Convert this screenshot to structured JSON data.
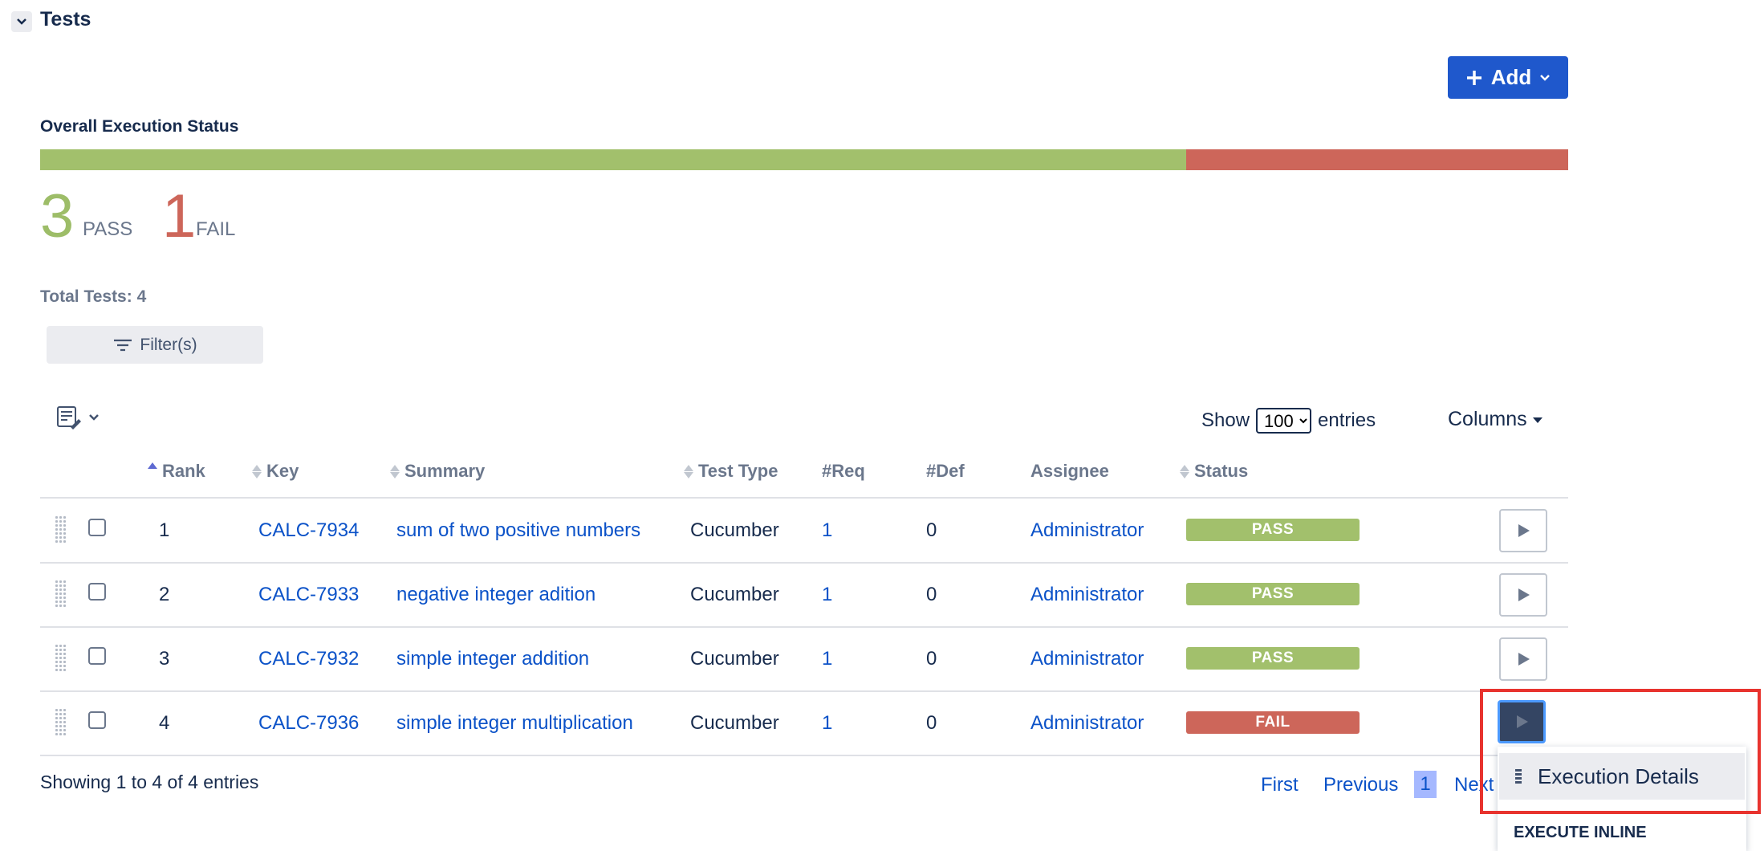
{
  "section": {
    "title": "Tests"
  },
  "toolbar": {
    "add_label": "Add"
  },
  "execution": {
    "label": "Overall Execution Status",
    "pass_count": "3",
    "pass_label": "PASS",
    "fail_count": "1",
    "fail_label": "FAIL",
    "pass_fraction": 0.75,
    "fail_fraction": 0.25,
    "pass_color": "#a2c06c",
    "fail_color": "#cd665a"
  },
  "total_tests": "Total Tests: 4",
  "filter": {
    "label": "Filter(s)"
  },
  "entries": {
    "show_label": "Show",
    "value": "100",
    "suffix": "entries"
  },
  "columns_label": "Columns",
  "table": {
    "headers": {
      "rank": "Rank",
      "key": "Key",
      "summary": "Summary",
      "test_type": "Test Type",
      "req": "#Req",
      "def": "#Def",
      "assignee": "Assignee",
      "status": "Status"
    },
    "rows": [
      {
        "rank": "1",
        "key": "CALC-7934",
        "summary": "sum of two positive numbers",
        "test_type": "Cucumber",
        "req": "1",
        "def": "0",
        "assignee": "Administrator",
        "status": "PASS"
      },
      {
        "rank": "2",
        "key": "CALC-7933",
        "summary": "negative integer adition",
        "test_type": "Cucumber",
        "req": "1",
        "def": "0",
        "assignee": "Administrator",
        "status": "PASS"
      },
      {
        "rank": "3",
        "key": "CALC-7932",
        "summary": "simple integer addition",
        "test_type": "Cucumber",
        "req": "1",
        "def": "0",
        "assignee": "Administrator",
        "status": "PASS"
      },
      {
        "rank": "4",
        "key": "CALC-7936",
        "summary": "simple integer multiplication",
        "test_type": "Cucumber",
        "req": "1",
        "def": "0",
        "assignee": "Administrator",
        "status": "FAIL"
      }
    ]
  },
  "footer": {
    "info": "Showing 1 to 4 of 4 entries",
    "first": "First",
    "previous": "Previous",
    "current_page": "1",
    "next": "Next"
  },
  "dropdown": {
    "item": "Execution Details",
    "section": "EXECUTE INLINE"
  },
  "icons": {
    "toggle": "chevron-down-icon",
    "add": "plus-icon",
    "filter": "filter-icon",
    "columns": "column-config-icon",
    "run": "play-icon",
    "details": "list-icon"
  }
}
